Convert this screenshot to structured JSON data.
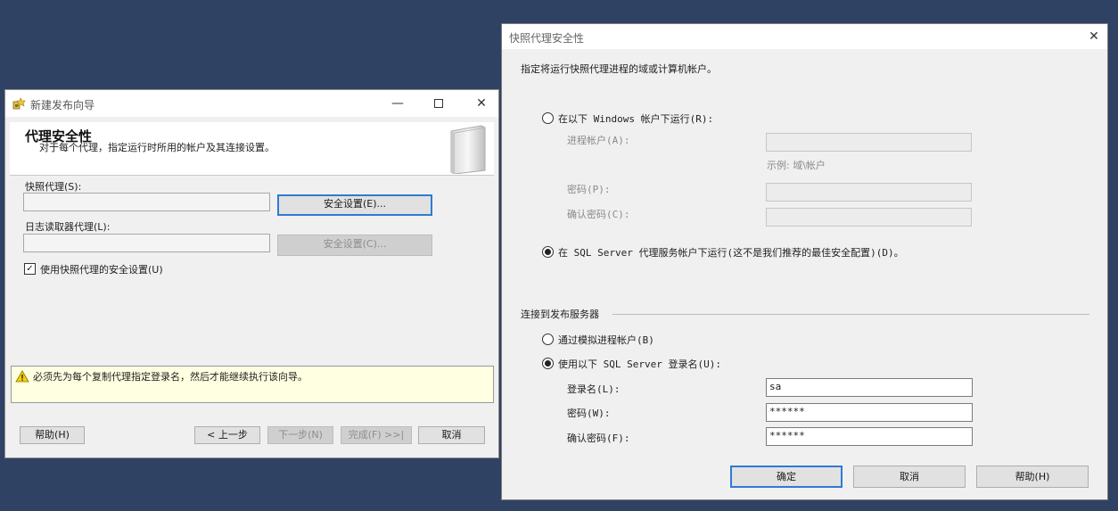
{
  "wizard": {
    "window_title": "新建发布向导",
    "header_title": "代理安全性",
    "header_subtitle": "对于每个代理，指定运行时所用的帐户及其连接设置。",
    "snapshot_agent_label": "快照代理(S):",
    "snapshot_agent_value": "",
    "security_settings_label": "安全设置(E)...",
    "log_reader_label": "日志读取器代理(L):",
    "log_reader_value": "",
    "security_settings_disabled_label": "安全设置(C)...",
    "use_snapshot_security_label": "使用快照代理的安全设置(U)",
    "use_snapshot_security_checked": true,
    "warning_message": "必须先为每个复制代理指定登录名，然后才能继续执行该向导。",
    "buttons": {
      "help": "帮助(H)",
      "back": "< 上一步",
      "next": "下一步(N)",
      "finish": "完成(F) >>|",
      "cancel": "取消"
    }
  },
  "dialog": {
    "window_title": "快照代理安全性",
    "instruction": "指定将运行快照代理进程的域或计算机帐户。",
    "run_windows_account_label": "在以下 Windows 帐户下运行(R):",
    "process_account_label": "进程帐户(A):",
    "process_account_value": "",
    "example_text": "示例: 域\\帐户",
    "password_label": "密码(P):",
    "confirm_password_label": "确认密码(C):",
    "run_agent_account_label": "在 SQL Server 代理服务帐户下运行(这不是我们推荐的最佳安全配置)(D)。",
    "connect_section_label": "连接到发布服务器",
    "impersonate_label": "通过模拟进程帐户(B)",
    "use_sql_login_label": "使用以下 SQL Server 登录名(U):",
    "login_label": "登录名(L):",
    "login_value": "sa",
    "sql_password_label": "密码(W):",
    "sql_password_value": "******",
    "sql_confirm_label": "确认密码(F):",
    "sql_confirm_value": "******",
    "buttons": {
      "ok": "确定",
      "cancel": "取消",
      "help": "帮助(H)"
    }
  }
}
